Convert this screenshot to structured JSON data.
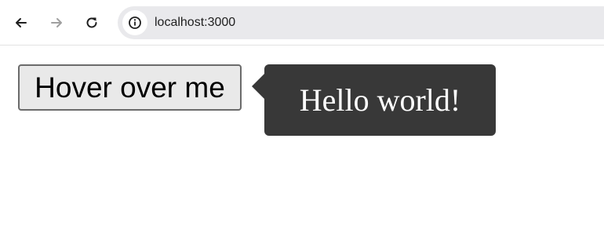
{
  "browser": {
    "url": "localhost:3000",
    "icons": {
      "back": "arrow-left-icon",
      "forward": "arrow-right-icon",
      "reload": "reload-icon",
      "site_info": "info-icon"
    }
  },
  "page": {
    "button_label": "Hover over me",
    "tooltip_text": "Hello world!"
  },
  "colors": {
    "tooltip_bg": "#383838",
    "button_bg": "#e9e9e9",
    "address_bar_bg": "#e9e9ec"
  }
}
